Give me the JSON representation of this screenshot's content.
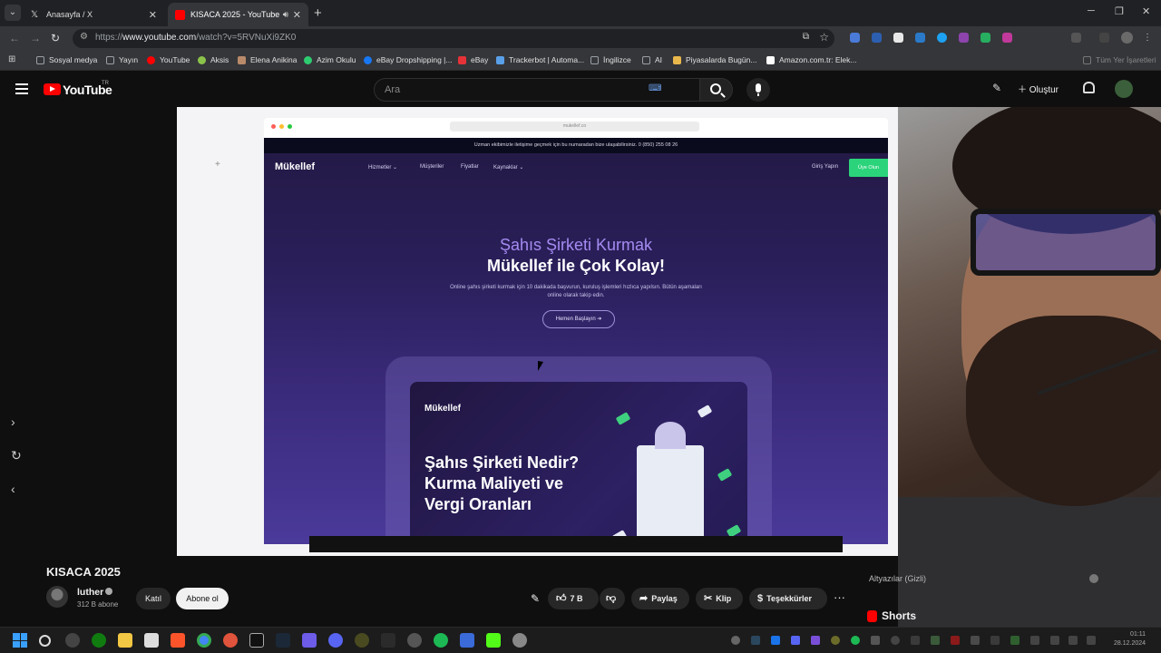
{
  "browser": {
    "tabs": [
      {
        "title": "Anasayfa / X",
        "icon": "x-icon"
      },
      {
        "title": "KISACA 2025 - YouTube",
        "icon": "youtube-icon",
        "audio": true
      }
    ],
    "url_prefix": "https://",
    "url_host": "www.youtube.com",
    "url_path": "/watch?v=5RVNuXi9ZK0",
    "bookmarks": [
      {
        "label": "Sosyal medya",
        "icon": "folder-icon",
        "color": "#9aa0a6"
      },
      {
        "label": "Yayın",
        "icon": "folder-icon",
        "color": "#9aa0a6"
      },
      {
        "label": "YouTube",
        "icon": "youtube-icon",
        "color": "#ff0000"
      },
      {
        "label": "Aksis",
        "icon": "aksis-icon",
        "color": "#8bc34a"
      },
      {
        "label": "Elena Anikina",
        "icon": "profile-icon",
        "color": "#b98a6a"
      },
      {
        "label": "Azim Okulu",
        "icon": "azim-icon",
        "color": "#2ecc71"
      },
      {
        "label": "eBay Dropshipping |...",
        "icon": "facebook-icon",
        "color": "#1877f2"
      },
      {
        "label": "eBay",
        "icon": "ebay-icon",
        "color": "#e53238"
      },
      {
        "label": "Trackerbot | Automa...",
        "icon": "trackerbot-icon",
        "color": "#5aa0e8"
      },
      {
        "label": "İngilizce",
        "icon": "folder-icon",
        "color": "#9aa0a6"
      },
      {
        "label": "AI",
        "icon": "folder-icon",
        "color": "#9aa0a6"
      },
      {
        "label": "Piyasalarda Bugün...",
        "icon": "chart-icon",
        "color": "#e9b84c"
      },
      {
        "label": "Amazon.com.tr: Elek...",
        "icon": "amazon-icon",
        "color": "#ffffff"
      }
    ],
    "all_bookmarks": "Tüm Yer İşaretleri"
  },
  "youtube": {
    "logo_text": "YouTube",
    "country_code": "TR",
    "search_placeholder": "Ara",
    "create_label": "Oluştur"
  },
  "video_frame": {
    "site_url": "mukellef.co",
    "notice": "Uzman ekibimizle iletişime geçmek için bu numaradan bize ulaşabilirsiniz.   0 (850) 255 08 26",
    "logo": "Mükellef",
    "nav": [
      "Hizmetler ⌄",
      "Müşteriler",
      "Fiyatlar",
      "Kaynaklar ⌄"
    ],
    "login": "Giriş Yapın",
    "cta_green": "Üye Olun",
    "headline_1": "Şahıs Şirketi Kurmak",
    "headline_2": "Mükellef ile Çok Kolay!",
    "subtext": "Online şahıs şirketi kurmak için 10 dakikada başvurun, kuruluş işlemleri hızlıca yapılsın. Bütün aşamaları online olarak takip edin.",
    "button": "Hemen Başlayın  ➔",
    "card_title": "Şahıs Şirketi Nedir? Kurma Maliyeti ve Vergi Oranları"
  },
  "video": {
    "title": "KISACA 2025",
    "channel": "luther",
    "subscribers": "312 B abone",
    "join_label": "Katıl",
    "subscribe_label": "Abone ol",
    "likes": "7 B",
    "share_label": "Paylaş",
    "clip_label": "Klip",
    "thanks_label": "Teşekkürler",
    "more_label": "···"
  },
  "sidebar_right": {
    "subtitles_label": "Altyazılar (Gizli)",
    "shorts_label": "Shorts"
  },
  "taskbar": {
    "time": "01:11",
    "date": "28.12.2024"
  }
}
